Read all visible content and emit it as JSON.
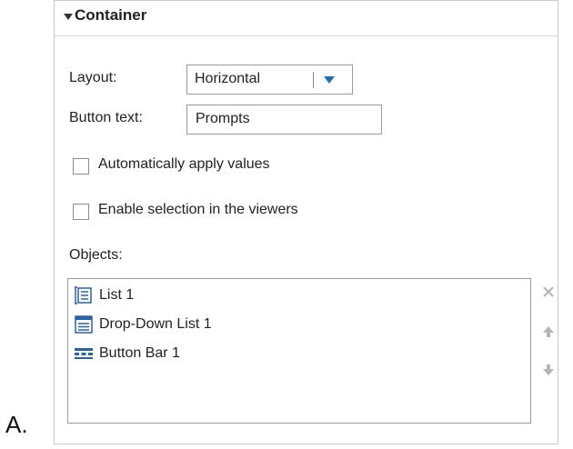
{
  "outer_label": "A.",
  "panel": {
    "title": "Container",
    "layout": {
      "label": "Layout:",
      "value": "Horizontal"
    },
    "button_text": {
      "label": "Button text:",
      "value": "Prompts"
    },
    "auto_apply": {
      "label": "Automatically apply values",
      "checked": false
    },
    "enable_selection": {
      "label": "Enable selection in the viewers",
      "checked": false
    },
    "objects": {
      "label": "Objects:",
      "items": [
        {
          "label": "List 1",
          "icon": "list-icon"
        },
        {
          "label": "Drop-Down List 1",
          "icon": "dropdown-list-icon"
        },
        {
          "label": "Button Bar 1",
          "icon": "button-bar-icon"
        }
      ]
    },
    "side_buttons": [
      "remove-icon",
      "move-up-icon",
      "move-down-icon"
    ],
    "colors": {
      "accent": "#1f6fb8",
      "icon_blue": "#2a62a8",
      "disabled": "#b5b5b5"
    }
  }
}
